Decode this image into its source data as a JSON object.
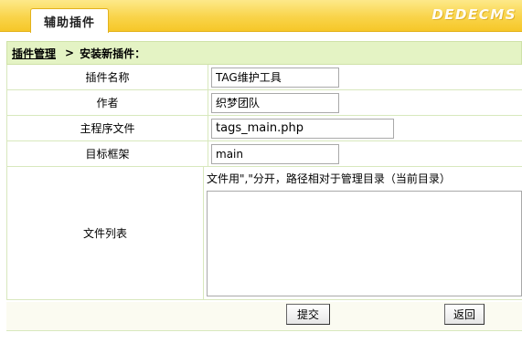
{
  "header": {
    "tab_label": "辅助插件",
    "logo_text": "DEDECMS"
  },
  "breadcrumb": {
    "link_label": "插件管理",
    "separator": ">",
    "current": "安装新插件："
  },
  "form": {
    "plugin_name": {
      "label": "插件名称",
      "value": "TAG维护工具"
    },
    "author": {
      "label": "作者",
      "value": "织梦团队"
    },
    "main_file": {
      "label": "主程序文件",
      "value": "tags_main.php"
    },
    "target_frame": {
      "label": "目标框架",
      "value": "main"
    },
    "file_list": {
      "label": "文件列表",
      "hint": "文件用\",\"分开，路径相对于管理目录（当前目录）",
      "value": ""
    }
  },
  "buttons": {
    "submit_label": "提交",
    "back_label": "返回"
  },
  "colors": {
    "header_yellow": "#f9d44a",
    "crumb_green": "#e4f3c4",
    "border": "#d8e8bd"
  }
}
